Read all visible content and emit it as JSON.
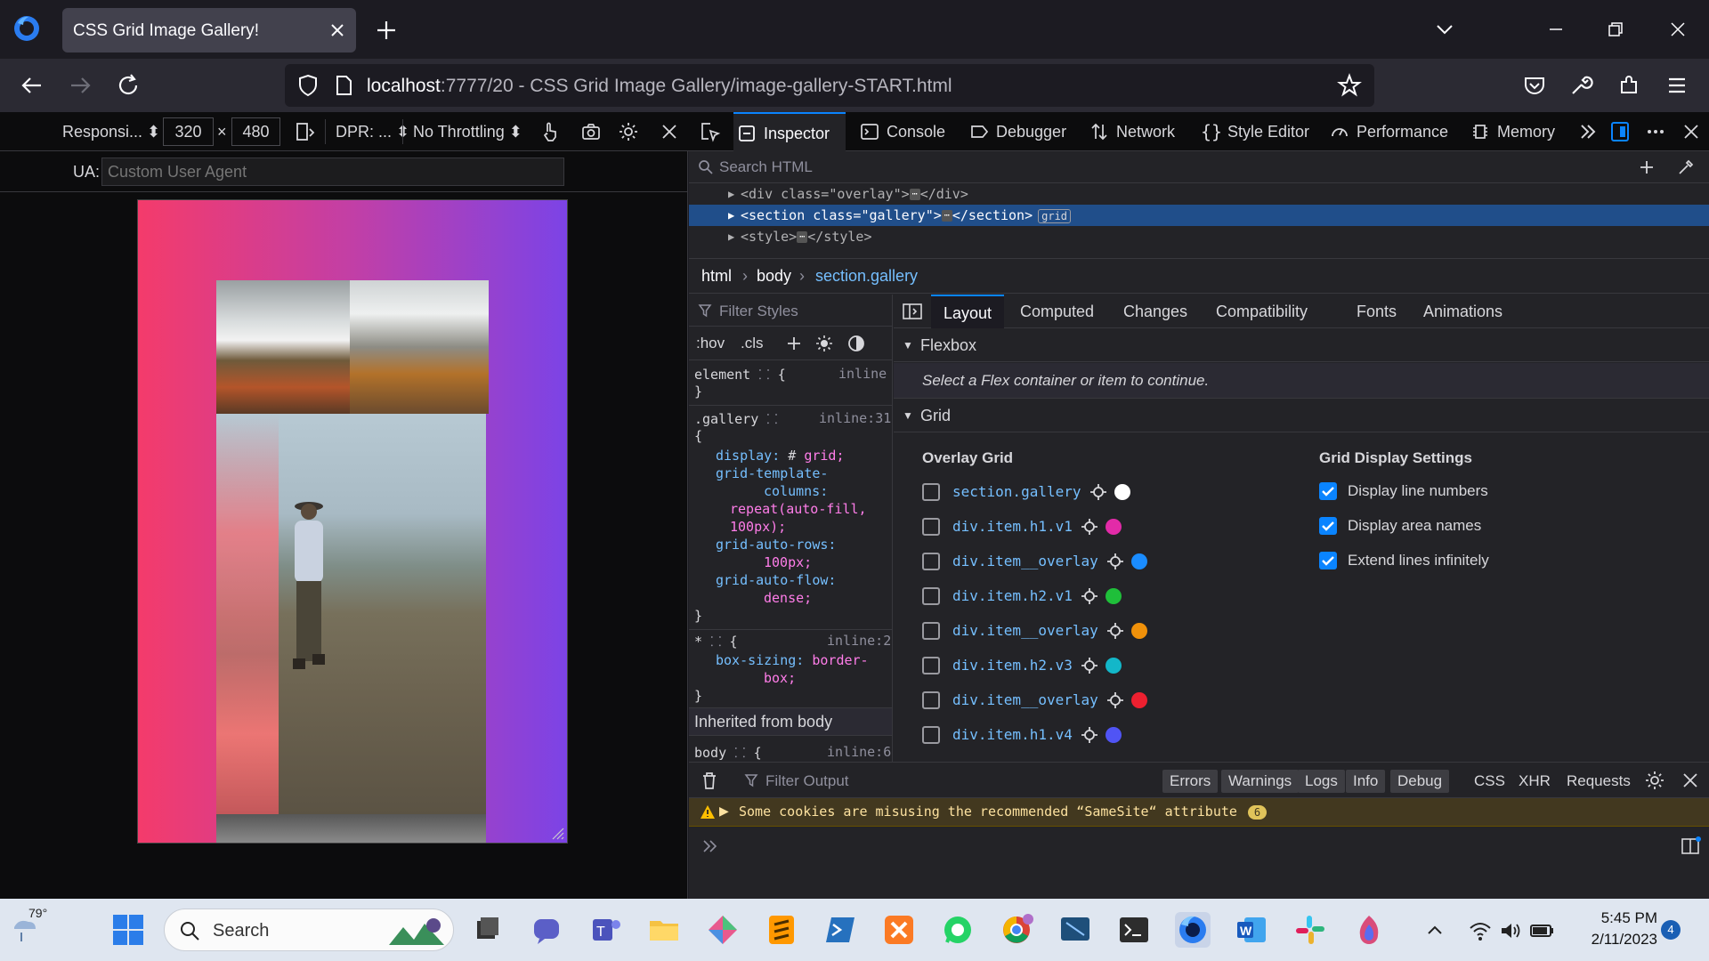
{
  "browser": {
    "tab_title": "CSS Grid Image Gallery!",
    "url_host": "localhost",
    "url_rest": ":7777/20 - CSS Grid Image Gallery/image-gallery-START.html"
  },
  "rdm": {
    "device": "Responsi...",
    "width": "320",
    "times": "×",
    "height": "480",
    "dpr": "DPR: ...",
    "throttling": "No Throttling",
    "ua_label": "UA:",
    "ua_placeholder": "Custom User Agent"
  },
  "devtools_tabs": {
    "inspector": "Inspector",
    "console": "Console",
    "debugger": "Debugger",
    "network": "Network",
    "style_editor": "Style Editor",
    "performance": "Performance",
    "memory": "Memory"
  },
  "inspector": {
    "search_placeholder": "Search HTML",
    "markup": [
      "<div class=\"overlay\">",
      "</div>",
      "<section class=\"gallery\">",
      "</section>",
      "<style>",
      "</style>"
    ],
    "grid_badge": "grid",
    "dots": "⋯",
    "breadcrumbs": [
      "html",
      "body",
      "section.gallery"
    ]
  },
  "rules": {
    "filter_placeholder": "Filter Styles",
    "hov": ":hov",
    "cls": ".cls",
    "element_selector": "element",
    "element_source": "inline",
    "open_brace": "{",
    "close_brace": "}",
    "gallery_selector": ".gallery",
    "gallery_source": "inline:31",
    "display_prop": "display:",
    "display_val": "grid;",
    "gtc_prop_1": "grid-template-",
    "gtc_prop_2": "columns:",
    "gtc_val_1": "repeat(auto-fill,",
    "gtc_val_2": "100px);",
    "gar_prop": "grid-auto-rows:",
    "gar_val": "100px;",
    "gaf_prop": "grid-auto-flow:",
    "gaf_val": "dense;",
    "star_selector": "*",
    "star_source": "inline:2",
    "bs_prop": "box-sizing:",
    "bs_val_1": "border-",
    "bs_val_2": "box;",
    "inherited_label": "Inherited from body",
    "body_selector": "body",
    "body_source": "inline:6"
  },
  "layout_panel": {
    "tabs": [
      "Layout",
      "Computed",
      "Changes",
      "Compatibility",
      "Fonts",
      "Animations"
    ],
    "flexbox_heading": "Flexbox",
    "flex_note": "Select a Flex container or item to continue.",
    "grid_heading": "Grid",
    "overlay_grid_heading": "Overlay Grid",
    "grid_display_heading": "Grid Display Settings",
    "overlay_items": [
      {
        "selector": "section.gallery",
        "color": "#ffffff"
      },
      {
        "selector": "div.item.h1.v1",
        "color": "#e22ba8"
      },
      {
        "selector": "div.item__overlay",
        "color": "#1a8cff"
      },
      {
        "selector": "div.item.h2.v1",
        "color": "#1fbf3a"
      },
      {
        "selector": "div.item__overlay",
        "color": "#f0910a"
      },
      {
        "selector": "div.item.h2.v3",
        "color": "#13b7c9"
      },
      {
        "selector": "div.item__overlay",
        "color": "#ed2030"
      },
      {
        "selector": "div.item.h1.v4",
        "color": "#5054f5"
      }
    ],
    "display_settings": [
      {
        "label": "Display line numbers",
        "checked": true
      },
      {
        "label": "Display area names",
        "checked": true
      },
      {
        "label": "Extend lines infinitely",
        "checked": true
      }
    ]
  },
  "console": {
    "filter_placeholder": "Filter Output",
    "levels": [
      "Errors",
      "Warnings",
      "Logs",
      "Info",
      "Debug"
    ],
    "types": [
      "CSS",
      "XHR",
      "Requests"
    ],
    "warning_message": "Some cookies are misusing the recommended “SameSite“ attribute",
    "warning_count": "6"
  },
  "taskbar": {
    "temperature": "79°",
    "search_label": "Search",
    "time": "5:45 PM",
    "date": "2/11/2023",
    "notifications": "4"
  }
}
